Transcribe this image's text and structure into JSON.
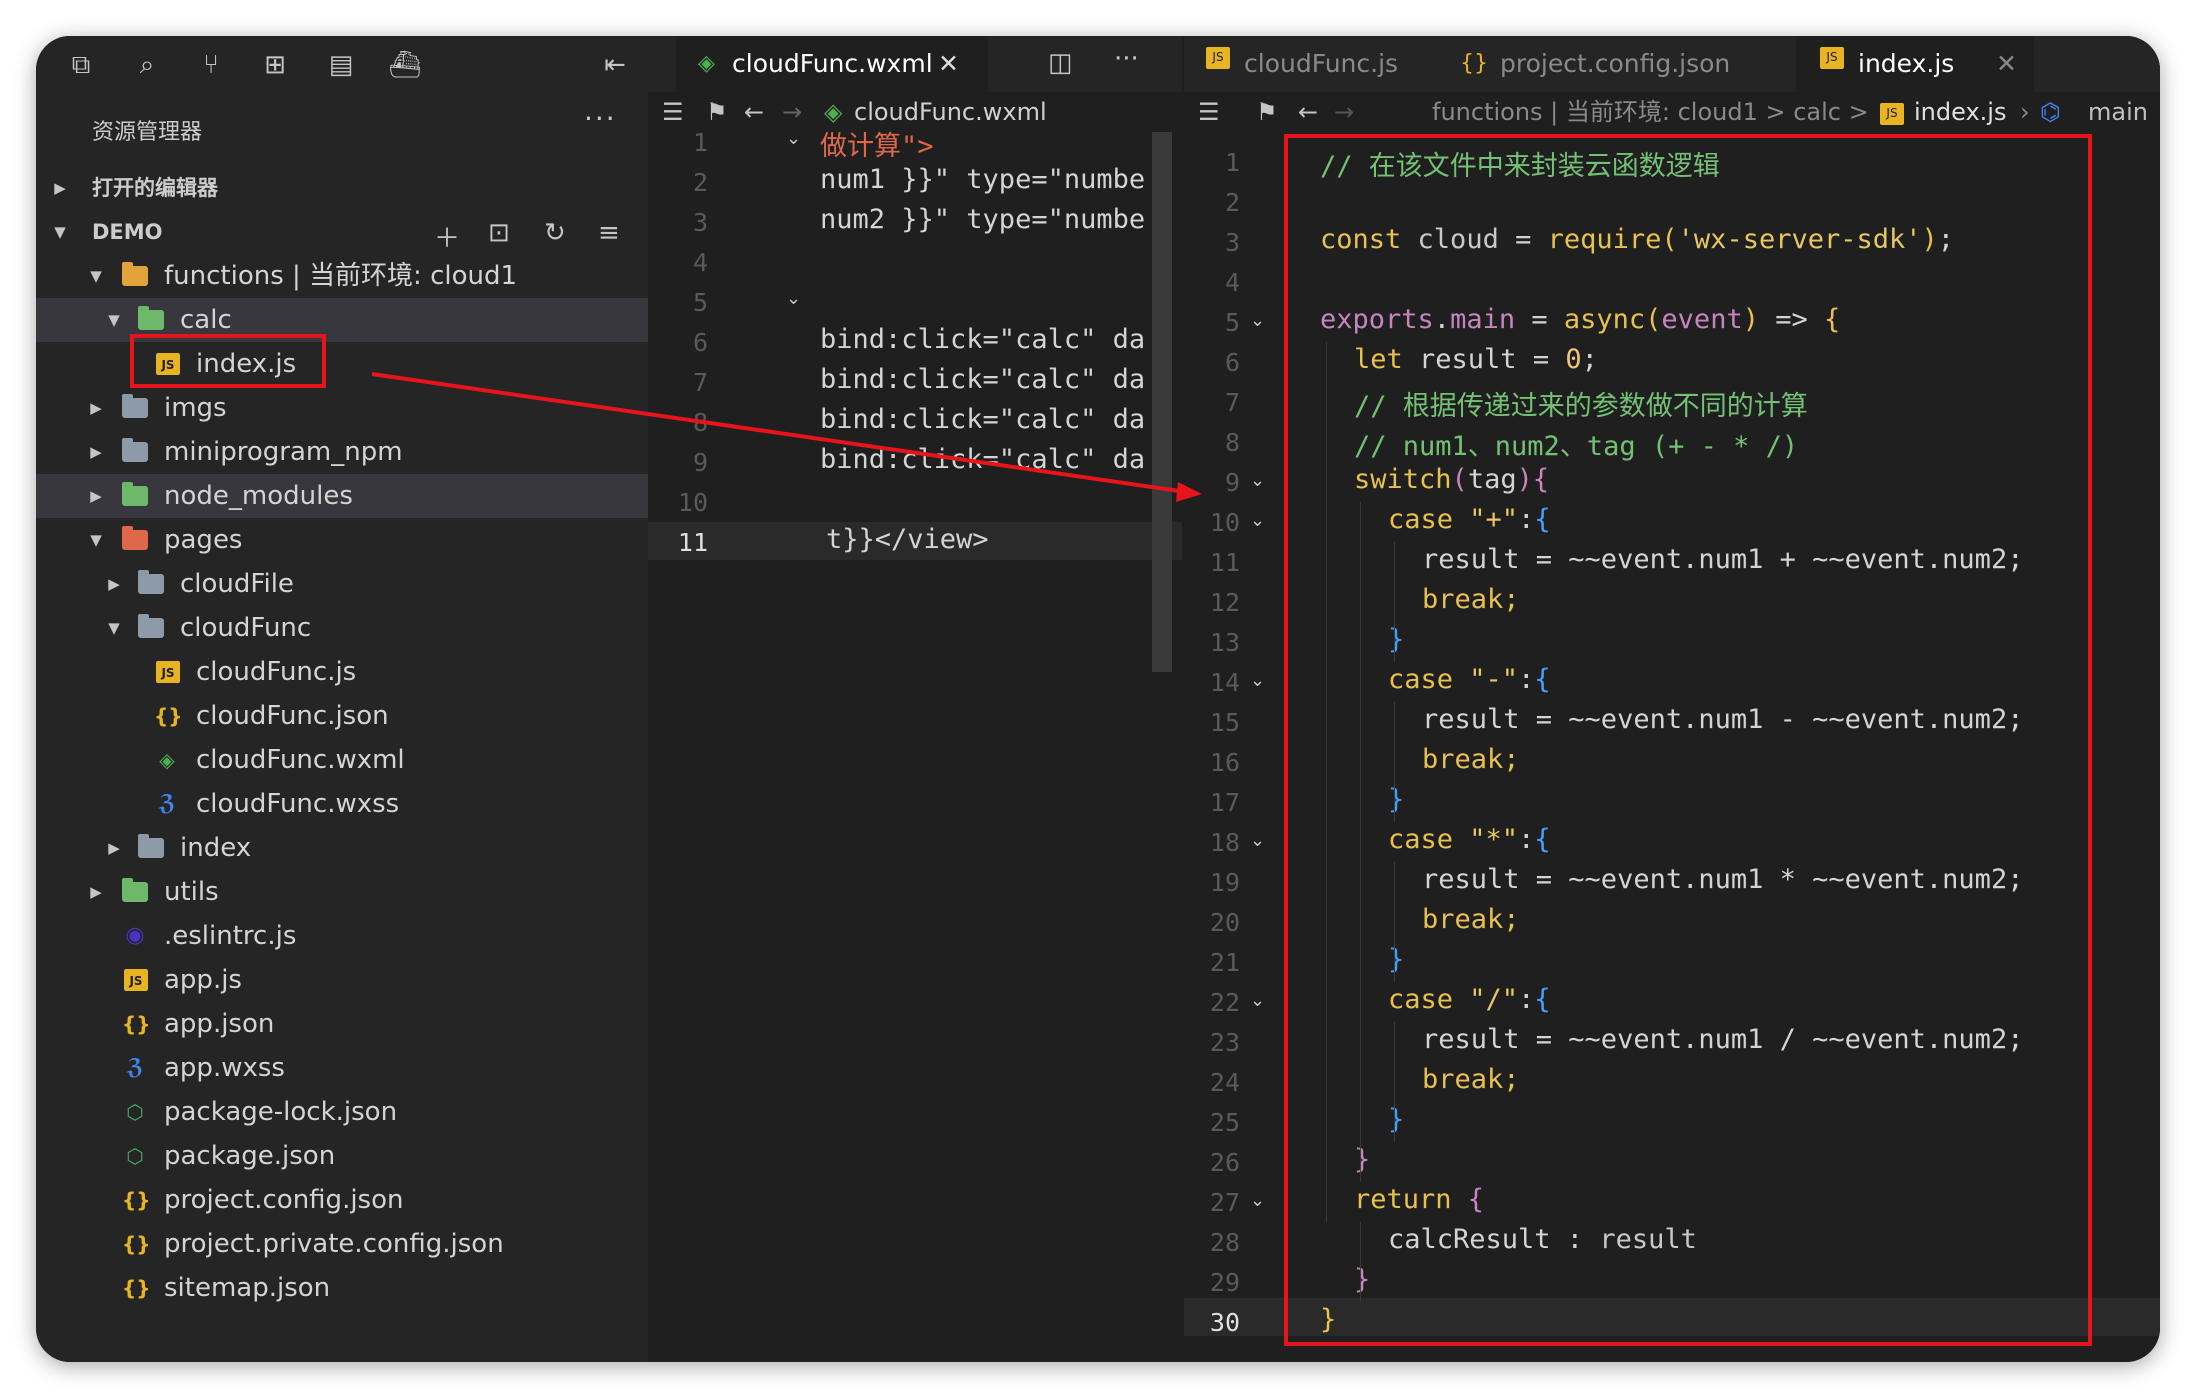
{
  "sidebar": {
    "title": "资源管理器",
    "more": "···",
    "open_editors": "打开的编辑器",
    "workspace": "DEMO",
    "tree": [
      {
        "label": "functions | 当前环境: cloud1"
      },
      {
        "label": "calc"
      },
      {
        "label": "index.js"
      },
      {
        "label": "imgs"
      },
      {
        "label": "miniprogram_npm"
      },
      {
        "label": "node_modules"
      },
      {
        "label": "pages"
      },
      {
        "label": "cloudFile"
      },
      {
        "label": "cloudFunc"
      },
      {
        "label": "cloudFunc.js"
      },
      {
        "label": "cloudFunc.json"
      },
      {
        "label": "cloudFunc.wxml"
      },
      {
        "label": "cloudFunc.wxss"
      },
      {
        "label": "index"
      },
      {
        "label": "utils"
      },
      {
        "label": ".eslintrc.js"
      },
      {
        "label": "app.js"
      },
      {
        "label": "app.json"
      },
      {
        "label": "app.wxss"
      },
      {
        "label": "package-lock.json"
      },
      {
        "label": "package.json"
      },
      {
        "label": "project.config.json"
      },
      {
        "label": "project.private.config.json"
      },
      {
        "label": "sitemap.json"
      }
    ]
  },
  "group1": {
    "tab": "cloudFunc.wxml",
    "crumb": "cloudFunc.wxml",
    "lines": [
      {
        "n": "1",
        "t": "做计算\">"
      },
      {
        "n": "2",
        "t": "num1 }}\" type=\"numbe"
      },
      {
        "n": "3",
        "t": "num2 }}\" type=\"numbe"
      },
      {
        "n": "4",
        "t": ""
      },
      {
        "n": "5",
        "t": ""
      },
      {
        "n": "6",
        "t": "bind:click=\"calc\" da"
      },
      {
        "n": "7",
        "t": "bind:click=\"calc\" da"
      },
      {
        "n": "8",
        "t": "bind:click=\"calc\" da"
      },
      {
        "n": "9",
        "t": "bind:click=\"calc\" da"
      },
      {
        "n": "10",
        "t": ""
      },
      {
        "n": "11",
        "t": "t}}</view>"
      }
    ]
  },
  "group2": {
    "tabs": [
      "cloudFunc.js",
      "project.config.json",
      "index.js"
    ],
    "crumbs": {
      "path": "functions | 当前环境: cloud1 > calc >",
      "file": "index.js",
      "sym": "main"
    },
    "line_numbers": [
      "1",
      "2",
      "3",
      "4",
      "5",
      "6",
      "7",
      "8",
      "9",
      "10",
      "11",
      "12",
      "13",
      "14",
      "15",
      "16",
      "17",
      "18",
      "19",
      "20",
      "21",
      "22",
      "23",
      "24",
      "25",
      "26",
      "27",
      "28",
      "29",
      "30"
    ],
    "code": {
      "l1": "// 在该文件中来封装云函数逻辑",
      "l3_kw": "const",
      "l3_var": "cloud",
      "l3_eq": "=",
      "l3_fn": "require",
      "l3_str": "'wx-server-sdk'",
      "l5_obj": "exports",
      "l5_prop": "main",
      "l5_kw": "async",
      "l5_param": "event",
      "l6": "let result = 0;",
      "l7": "// 根据传递过来的参数做不同的计算",
      "l8": "// num1、num2、tag (+ - * /)",
      "l9_kw": "switch",
      "l9_arg": "tag",
      "case_kw": "case",
      "c1": "\"+\"",
      "c2": "\"-\"",
      "c3": "\"*\"",
      "c4": "\"/\"",
      "r1": "result = ~~event.num1 + ~~event.num2;",
      "r2": "result = ~~event.num1 - ~~event.num2;",
      "r3": "result = ~~event.num1 * ~~event.num2;",
      "r4": "result = ~~event.num1 / ~~event.num2;",
      "brk": "break;",
      "ret": "return",
      "res_key": "calcResult",
      "res_val": "result"
    }
  },
  "colors": {
    "highlight": "#e8141b",
    "bg": "#1f1f1f"
  }
}
